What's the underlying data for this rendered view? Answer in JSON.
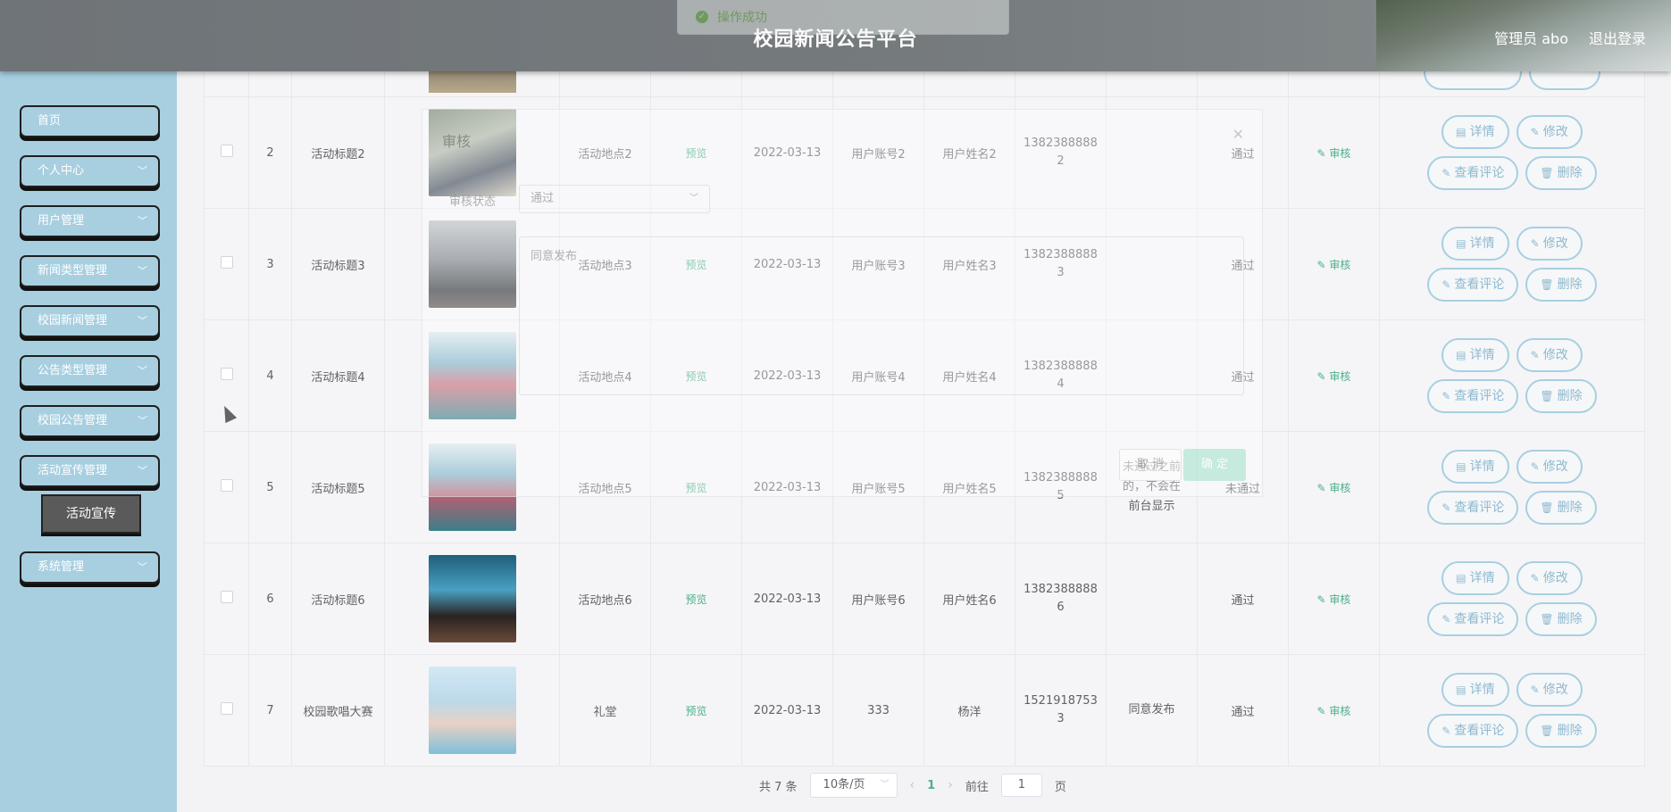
{
  "header": {
    "title": "校园新闻公告平台",
    "admin": "管理员 abo",
    "logout": "退出登录"
  },
  "toast": {
    "text": "操作成功"
  },
  "sidebar": {
    "items": [
      {
        "label": "首页",
        "has_children": false
      },
      {
        "label": "个人中心",
        "has_children": true
      },
      {
        "label": "用户管理",
        "has_children": true
      },
      {
        "label": "新闻类型管理",
        "has_children": true
      },
      {
        "label": "校园新闻管理",
        "has_children": true
      },
      {
        "label": "公告类型管理",
        "has_children": true
      },
      {
        "label": "校园公告管理",
        "has_children": true
      },
      {
        "label": "活动宣传管理",
        "has_children": true
      },
      {
        "label": "系统管理",
        "has_children": true
      }
    ],
    "active_sub": "活动宣传"
  },
  "table": {
    "preview_label": "预览",
    "audit_label": "审核",
    "ops": {
      "detail": "详情",
      "edit": "修改",
      "comments": "查看评论",
      "delete": "删除"
    },
    "rows": [
      {
        "idx": "2",
        "title": "活动标题2",
        "place": "活动地点2",
        "date": "2022-03-13",
        "account": "用户账号2",
        "name": "用户姓名2",
        "phone1": "1382388888",
        "phone2": "2",
        "reply": "",
        "status": "通过"
      },
      {
        "idx": "3",
        "title": "活动标题3",
        "place": "活动地点3",
        "date": "2022-03-13",
        "account": "用户账号3",
        "name": "用户姓名3",
        "phone1": "1382388888",
        "phone2": "3",
        "reply": "",
        "status": "通过"
      },
      {
        "idx": "4",
        "title": "活动标题4",
        "place": "活动地点4",
        "date": "2022-03-13",
        "account": "用户账号4",
        "name": "用户姓名4",
        "phone1": "1382388888",
        "phone2": "4",
        "reply": "",
        "status": "通过"
      },
      {
        "idx": "5",
        "title": "活动标题5",
        "place": "活动地点5",
        "date": "2022-03-13",
        "account": "用户账号5",
        "name": "用户姓名5",
        "phone1": "1382388888",
        "phone2": "5",
        "reply": "未通过之前的，不会在前台显示",
        "status": "未通过"
      },
      {
        "idx": "6",
        "title": "活动标题6",
        "place": "活动地点6",
        "date": "2022-03-13",
        "account": "用户账号6",
        "name": "用户姓名6",
        "phone1": "1382388888",
        "phone2": "6",
        "reply": "",
        "status": "通过"
      },
      {
        "idx": "7",
        "title": "校园歌唱大赛",
        "place": "礼堂",
        "date": "2022-03-13",
        "account": "333",
        "name": "杨洋",
        "phone1": "1521918753",
        "phone2": "3",
        "reply": "同意发布",
        "status": "通过"
      }
    ]
  },
  "pagination": {
    "total": "共 7 条",
    "page_size": "10条/页",
    "current": "1",
    "goto_label": "前往",
    "goto_value": "1",
    "page_unit": "页"
  },
  "dialog": {
    "title": "审核",
    "status_label": "审核状态",
    "status_value": "通过",
    "reply_text": "同意发布",
    "cancel": "取 消",
    "confirm": "确 定"
  },
  "colors": {
    "sidebar": "#a8cfe0",
    "accent": "#4caf88",
    "button_border": "#a8cfe0"
  }
}
